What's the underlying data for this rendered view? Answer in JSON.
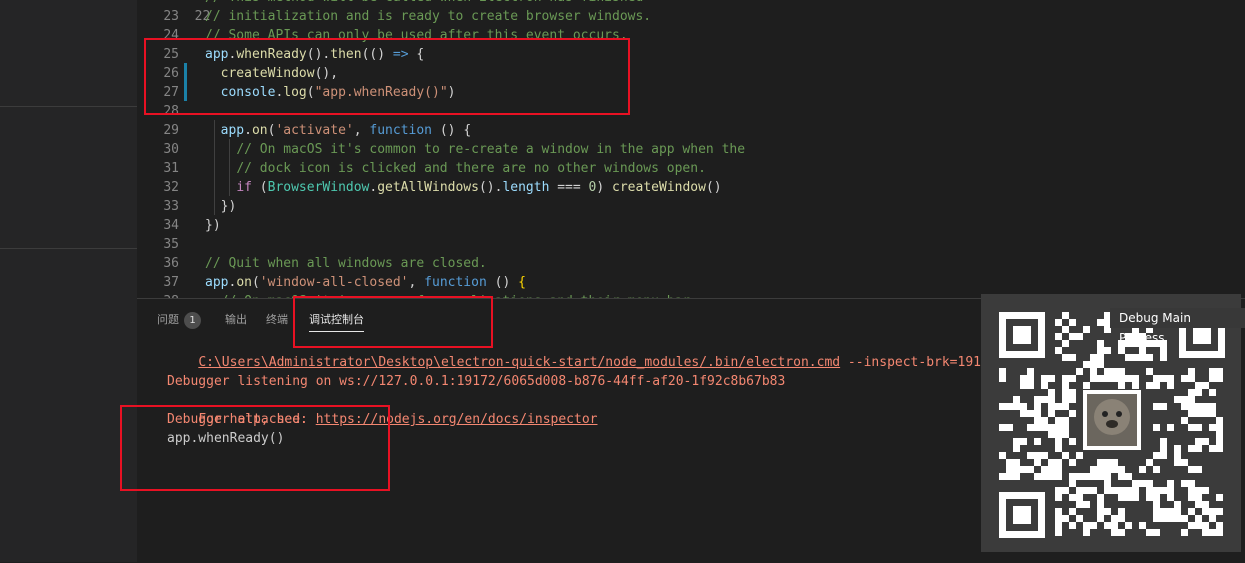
{
  "editor": {
    "lines": [
      {
        "num": "23",
        "tokens": [
          {
            "t": "// initialization and is ready to create browser windows.",
            "k": "c"
          }
        ]
      },
      {
        "num": "24",
        "tokens": [
          {
            "t": "// Some APIs can only be used after this event occurs.",
            "k": "c"
          }
        ]
      },
      {
        "num": "25",
        "tokens": [
          {
            "t": "app",
            "k": "v"
          },
          {
            "t": ".",
            "k": "p"
          },
          {
            "t": "whenReady",
            "k": "f"
          },
          {
            "t": "().",
            "k": "p"
          },
          {
            "t": "then",
            "k": "f"
          },
          {
            "t": "(() ",
            "k": "p"
          },
          {
            "t": "=>",
            "k": "k"
          },
          {
            "t": " {",
            "k": "p"
          }
        ]
      },
      {
        "num": "26",
        "tokens": [
          {
            "t": "  ",
            "k": "p"
          },
          {
            "t": "createWindow",
            "k": "f"
          },
          {
            "t": "(),",
            "k": "p"
          }
        ]
      },
      {
        "num": "27",
        "tokens": [
          {
            "t": "  ",
            "k": "p"
          },
          {
            "t": "console",
            "k": "v"
          },
          {
            "t": ".",
            "k": "p"
          },
          {
            "t": "log",
            "k": "f"
          },
          {
            "t": "(",
            "k": "p"
          },
          {
            "t": "\"app.whenReady()\"",
            "k": "s"
          },
          {
            "t": ")",
            "k": "p"
          }
        ]
      },
      {
        "num": "28",
        "tokens": []
      },
      {
        "num": "29",
        "tokens": [
          {
            "t": "  ",
            "k": "p"
          },
          {
            "t": "app",
            "k": "v"
          },
          {
            "t": ".",
            "k": "p"
          },
          {
            "t": "on",
            "k": "f"
          },
          {
            "t": "(",
            "k": "p"
          },
          {
            "t": "'activate'",
            "k": "s"
          },
          {
            "t": ", ",
            "k": "p"
          },
          {
            "t": "function",
            "k": "k"
          },
          {
            "t": " () {",
            "k": "p"
          }
        ]
      },
      {
        "num": "30",
        "tokens": [
          {
            "t": "    ",
            "k": "p"
          },
          {
            "t": "// On macOS it's common to re-create a window in the app when the",
            "k": "c"
          }
        ]
      },
      {
        "num": "31",
        "tokens": [
          {
            "t": "    ",
            "k": "p"
          },
          {
            "t": "// dock icon is clicked and there are no other windows open.",
            "k": "c"
          }
        ]
      },
      {
        "num": "32",
        "tokens": [
          {
            "t": "    ",
            "k": "p"
          },
          {
            "t": "if",
            "k": "ctrl"
          },
          {
            "t": " (",
            "k": "p"
          },
          {
            "t": "BrowserWindow",
            "k": "cls"
          },
          {
            "t": ".",
            "k": "p"
          },
          {
            "t": "getAllWindows",
            "k": "f"
          },
          {
            "t": "().",
            "k": "p"
          },
          {
            "t": "length",
            "k": "v"
          },
          {
            "t": " === ",
            "k": "p"
          },
          {
            "t": "0",
            "k": "n"
          },
          {
            "t": ") ",
            "k": "p"
          },
          {
            "t": "createWindow",
            "k": "f"
          },
          {
            "t": "()",
            "k": "p"
          }
        ]
      },
      {
        "num": "33",
        "tokens": [
          {
            "t": "  })",
            "k": "p"
          }
        ]
      },
      {
        "num": "34",
        "tokens": [
          {
            "t": "})",
            "k": "p"
          }
        ]
      },
      {
        "num": "35",
        "tokens": []
      },
      {
        "num": "36",
        "tokens": [
          {
            "t": "// Quit when all windows are closed.",
            "k": "c"
          }
        ]
      },
      {
        "num": "37",
        "tokens": [
          {
            "t": "app",
            "k": "v"
          },
          {
            "t": ".",
            "k": "p"
          },
          {
            "t": "on",
            "k": "f"
          },
          {
            "t": "(",
            "k": "p"
          },
          {
            "t": "'window-all-closed'",
            "k": "s"
          },
          {
            "t": ", ",
            "k": "p"
          },
          {
            "t": "function",
            "k": "k"
          },
          {
            "t": " () ",
            "k": "p"
          },
          {
            "t": "{",
            "k": "br"
          }
        ]
      }
    ]
  },
  "panel": {
    "tabs": [
      {
        "label": "问题",
        "badge": "1"
      },
      {
        "label": "输出"
      },
      {
        "label": "终端"
      },
      {
        "label": "调试控制台"
      }
    ],
    "console": {
      "path_link": "C:\\Users\\Administrator\\Desktop\\electron-quick-start/node_modules/.bin/electron.cmd",
      "path_args": " --inspect-brk=19172 .",
      "debugger_listening": "Debugger listening on ws://127.0.0.1:19172/6065d008-b876-44ff-af20-1f92c8b67b83",
      "help_prefix": "For help, see: ",
      "help_link": "https://nodejs.org/en/docs/inspector",
      "attached": "Debugger attached.",
      "log_output": "app.whenReady()"
    }
  },
  "overlay": {
    "debug_process_label": "Debug Main Process",
    "qr_icon": "qr-code-icon"
  },
  "annotation_color": "#e81123"
}
